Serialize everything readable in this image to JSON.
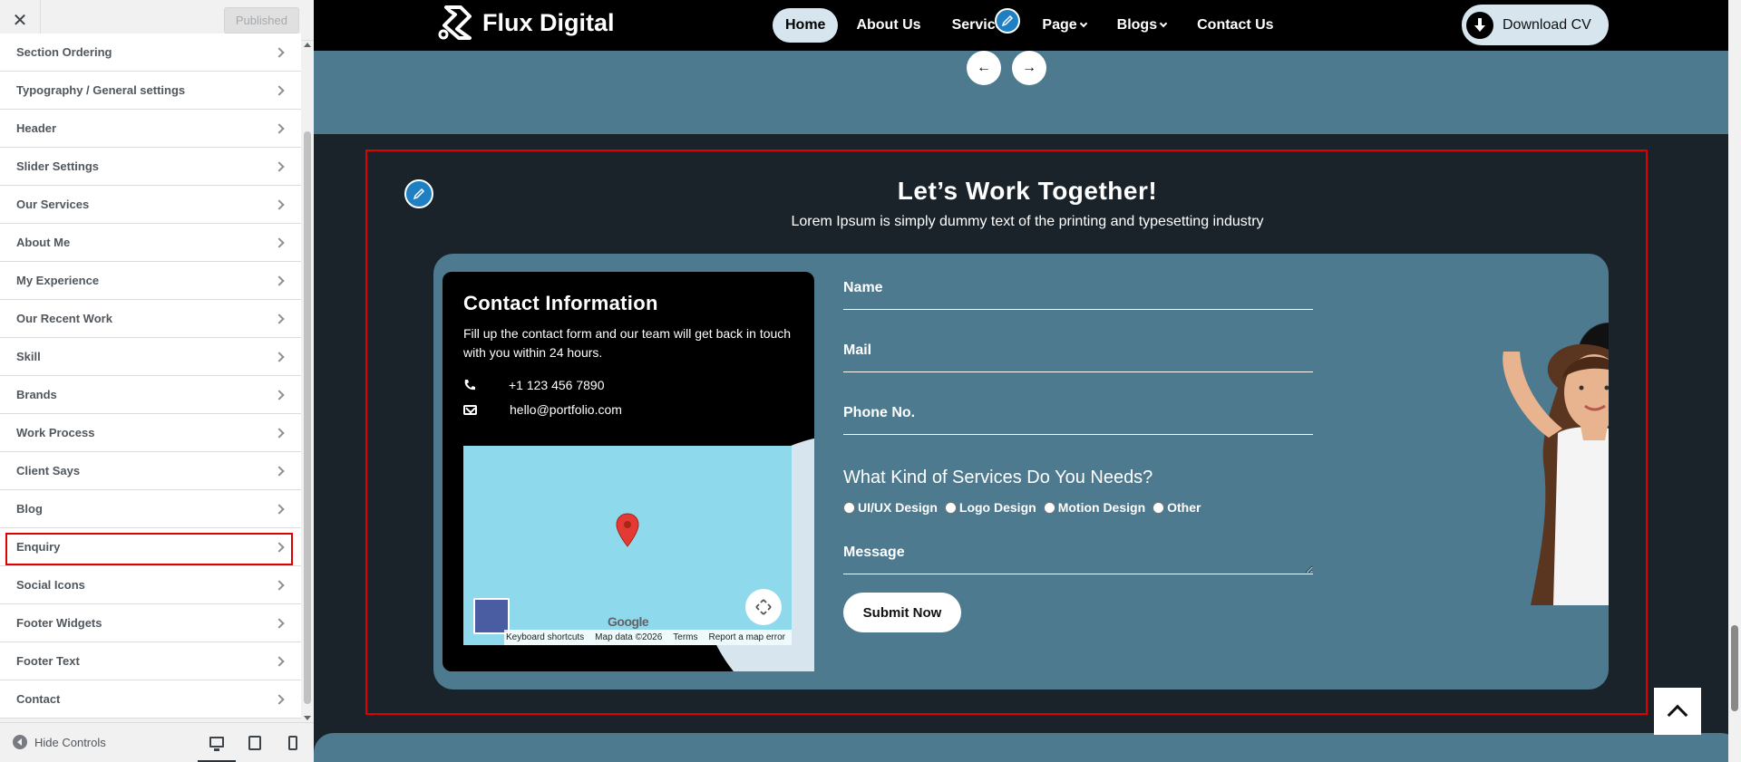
{
  "sidebar": {
    "close_label": "✕",
    "published_label": "Published",
    "items": [
      {
        "label": "Section Ordering"
      },
      {
        "label": "Typography / General settings"
      },
      {
        "label": "Header"
      },
      {
        "label": "Slider Settings"
      },
      {
        "label": "Our Services"
      },
      {
        "label": "About Me"
      },
      {
        "label": "My Experience"
      },
      {
        "label": "Our Recent Work"
      },
      {
        "label": "Skill"
      },
      {
        "label": "Brands"
      },
      {
        "label": "Work Process"
      },
      {
        "label": "Client Says"
      },
      {
        "label": "Blog"
      },
      {
        "label": "Enquiry",
        "active": true
      },
      {
        "label": "Social Icons"
      },
      {
        "label": "Footer Widgets"
      },
      {
        "label": "Footer Text"
      },
      {
        "label": "Contact"
      }
    ],
    "hide_controls_label": "Hide Controls",
    "devices": [
      "desktop",
      "tablet",
      "mobile"
    ]
  },
  "header": {
    "logo_text": "Flux Digital",
    "nav": [
      {
        "label": "Home",
        "active": true
      },
      {
        "label": "About Us"
      },
      {
        "label": "Services"
      },
      {
        "label": "Page",
        "dropdown": true
      },
      {
        "label": "Blogs",
        "dropdown": true
      },
      {
        "label": "Contact Us"
      }
    ],
    "download_label": "Download CV"
  },
  "slider_arrows": {
    "prev": "←",
    "next": "→"
  },
  "enquiry": {
    "title": "Let’s Work Together!",
    "subtitle": "Lorem Ipsum is simply dummy text of the printing and typesetting industry",
    "contact": {
      "title": "Contact Information",
      "description": "Fill up the contact form and our team will get back in touch with you within 24 hours.",
      "phone": "+1 123 456 7890",
      "email": "hello@portfolio.com"
    },
    "map": {
      "logo": "Google",
      "footer": [
        "Keyboard shortcuts",
        "Map data ©2026",
        "Terms",
        "Report a map error"
      ]
    },
    "form": {
      "name_label": "Name",
      "mail_label": "Mail",
      "phone_label": "Phone No.",
      "services_question": "What Kind of Services Do You Needs?",
      "services": [
        "UI/UX Design",
        "Logo Design",
        "Motion Design",
        "Other"
      ],
      "message_label": "Message",
      "submit_label": "Submit Now"
    }
  },
  "colors": {
    "accent": "#4d7a8f",
    "dark": "#1a2329",
    "highlight": "#e00000",
    "edit_icon": "#1e7fc3"
  }
}
